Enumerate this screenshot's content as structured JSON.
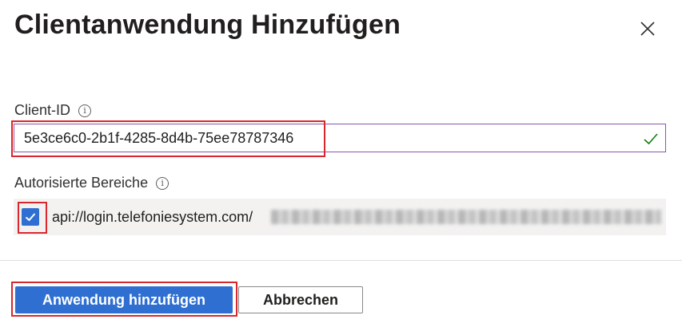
{
  "dialog": {
    "title": "Clientanwendung Hinzufügen",
    "close_icon": "close-icon"
  },
  "client_id": {
    "label": "Client-ID",
    "value": "5e3ce6c0-2b1f-4285-8d4b-75ee78787346",
    "valid_icon": "checkmark-icon"
  },
  "scopes": {
    "label": "Autorisierte Bereiche",
    "items": [
      {
        "checked": true,
        "text": "api://login.telefoniesystem.com/"
      }
    ]
  },
  "buttons": {
    "primary": "Anwendung hinzufügen",
    "secondary": "Abbrechen"
  },
  "colors": {
    "accent": "#2f6fd1",
    "highlight": "#d9272e",
    "valid": "#107c10",
    "input_border": "#8a57a8"
  }
}
